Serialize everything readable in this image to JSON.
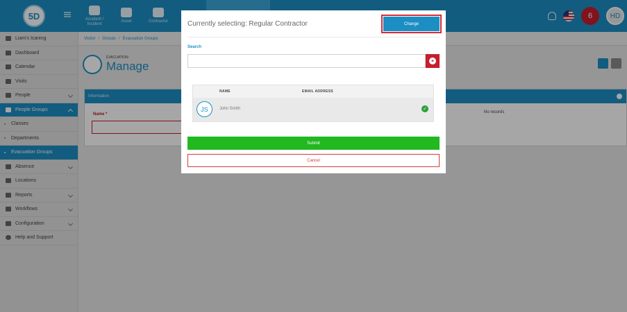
{
  "header": {
    "logo_text": "5D",
    "nav": [
      {
        "label": "Accident / Incident",
        "icon": "first-aid-kit-icon"
      },
      {
        "label": "Asset",
        "icon": "boxes-icon"
      },
      {
        "label": "Contractor",
        "icon": "hardhat-icon"
      },
      {
        "label": "",
        "icon": "document-icon"
      },
      {
        "label": "",
        "icon": "person-icon"
      },
      {
        "label": "",
        "icon": "helmet-icon"
      }
    ],
    "user_initials": "HD",
    "alert_glyph": "6"
  },
  "sidebar": {
    "items": [
      {
        "label": "Liam's Icaning",
        "icon": "flag-icon",
        "chevron": false,
        "active": false,
        "sub": false
      },
      {
        "label": "Dashboard",
        "icon": "dashboard-icon",
        "chevron": false,
        "active": false,
        "sub": false
      },
      {
        "label": "Calendar",
        "icon": "calendar-icon",
        "chevron": false,
        "active": false,
        "sub": false
      },
      {
        "label": "Visits",
        "icon": "visits-icon",
        "chevron": false,
        "active": false,
        "sub": false
      },
      {
        "label": "People",
        "icon": "people-icon",
        "chevron": true,
        "active": false,
        "sub": false
      },
      {
        "label": "People Groups",
        "icon": "people-groups-icon",
        "chevron": true,
        "active": true,
        "sub": false
      },
      {
        "label": "Classes",
        "icon": "",
        "chevron": false,
        "active": false,
        "sub": true
      },
      {
        "label": "Departments",
        "icon": "",
        "chevron": false,
        "active": false,
        "sub": true
      },
      {
        "label": "Evacuation Groups",
        "icon": "",
        "chevron": false,
        "active": true,
        "sub": true
      },
      {
        "label": "Absence",
        "icon": "absence-icon",
        "chevron": true,
        "active": false,
        "sub": false
      },
      {
        "label": "Locations",
        "icon": "locations-icon",
        "chevron": false,
        "active": false,
        "sub": false
      },
      {
        "label": "Reports",
        "icon": "reports-icon",
        "chevron": true,
        "active": false,
        "sub": false
      },
      {
        "label": "Workflows",
        "icon": "workflows-icon",
        "chevron": true,
        "active": false,
        "sub": false
      },
      {
        "label": "Configuration",
        "icon": "configuration-icon",
        "chevron": true,
        "active": false,
        "sub": false
      },
      {
        "label": "Help and Support",
        "icon": "help-icon",
        "chevron": false,
        "active": false,
        "sub": false
      }
    ]
  },
  "main": {
    "breadcrumb": {
      "part1": "Visitor",
      "sep1": "/",
      "part2": "Groups",
      "sep2": "/",
      "part3": "Evacuation Groups"
    },
    "page_sup": "EVACUATION",
    "page_title": "Manage",
    "panel_title": "Information",
    "name_label": "Name *",
    "no_records": "No records"
  },
  "modal": {
    "title": "Currently selecting:  Regular Contractor",
    "change_label": "Change",
    "search_label": "Search",
    "search_value": "",
    "clear_glyph": "×",
    "table": {
      "headers": [
        "NAME",
        "EMAIL ADDRESS"
      ],
      "rows": [
        {
          "initials": "JS",
          "name": "John Smith",
          "email": "",
          "selected": true
        }
      ]
    },
    "check_glyph": "✓",
    "submit_label": "Submit",
    "cancel_label": "Cancel"
  },
  "colors": {
    "primary": "#1d8ec4",
    "danger": "#c61e2e",
    "success": "#21b820",
    "highlight": "#d42a38"
  }
}
